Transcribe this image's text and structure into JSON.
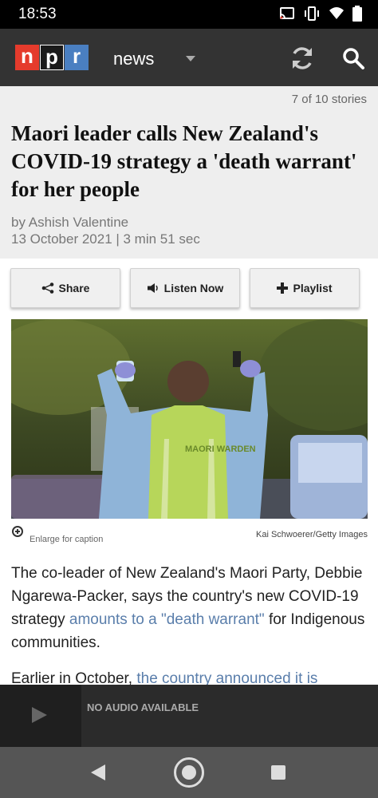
{
  "status_bar": {
    "time": "18:53",
    "icons": [
      "cast-icon",
      "vibrate-icon",
      "wifi-icon",
      "battery-icon"
    ]
  },
  "app_bar": {
    "logo_letters": [
      "n",
      "p",
      "r"
    ],
    "section": "news",
    "colors": {
      "n": "#e53b2c",
      "p": "#1a1a1a",
      "r": "#4a7fc1",
      "bar": "#333333"
    }
  },
  "story": {
    "counter": "7 of 10 stories",
    "headline": "Maori leader calls New Zealand's COVID-19 strategy a 'death warrant' for her people",
    "author": "by Ashish Valentine",
    "meta": "13 October 2021 | 3 min 51 sec"
  },
  "actions": {
    "share_label": "Share",
    "listen_label": "Listen Now",
    "playlist_label": "Playlist"
  },
  "photo": {
    "enlarge_label": "Enlarge for caption",
    "credit": "Kai Schwoerer/Getty Images",
    "vest_text": "MAORI WARDEN"
  },
  "article": {
    "p1_before": "The co-leader of New Zealand's Maori Party, Debbie Ngarewa-Packer, says the country's new COVID-19 strategy ",
    "p1_link": "amounts to a \"death warrant\"",
    "p1_after": " for Indigenous communities.",
    "p2_before": "Earlier in October, ",
    "p2_link": "the country announced it is"
  },
  "audio_bar": {
    "status": "NO AUDIO AVAILABLE"
  },
  "link_color": "#5a7eab"
}
